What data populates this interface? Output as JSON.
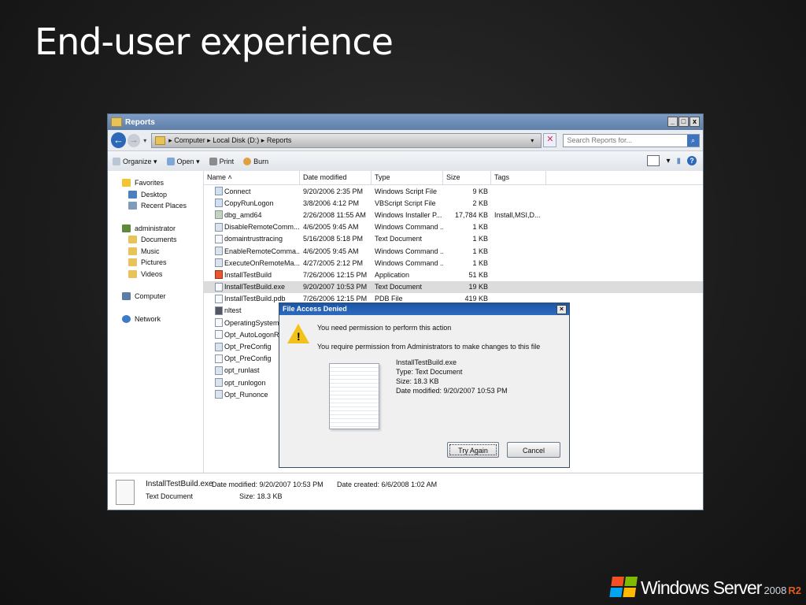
{
  "slide": {
    "title": "End-user experience",
    "brand": {
      "name": "Windows Server",
      "year": "2008",
      "edition": "R2"
    }
  },
  "window": {
    "title": "Reports",
    "controls": [
      "_",
      "□",
      "x"
    ],
    "address": {
      "crumbs": "▸ Computer ▸ Local Disk (D:) ▸ Reports"
    },
    "search": {
      "placeholder": "Search Reports for..."
    },
    "toolbar": {
      "organize": "Organize ▾",
      "open": "Open ▾",
      "print": "Print",
      "burn": "Burn"
    },
    "nav": {
      "favorites": "Favorites",
      "desktop": "Desktop",
      "recent": "Recent Places",
      "user": "administrator",
      "documents": "Documents",
      "music": "Music",
      "pictures": "Pictures",
      "videos": "Videos",
      "computer": "Computer",
      "network": "Network"
    },
    "columns": {
      "name": "Name",
      "date": "Date modified",
      "type": "Type",
      "size": "Size",
      "tags": "Tags"
    },
    "files": [
      {
        "name": "Connect",
        "date": "9/20/2006 2:35 PM",
        "type": "Windows Script File",
        "size": "9 KB",
        "tags": ""
      },
      {
        "name": "CopyRunLogon",
        "date": "3/8/2006 4:12 PM",
        "type": "VBScript Script File",
        "size": "2 KB",
        "tags": ""
      },
      {
        "name": "dbg_amd64",
        "date": "2/26/2008 11:55 AM",
        "type": "Windows Installer P...",
        "size": "17,784 KB",
        "tags": "Install,MSI,D..."
      },
      {
        "name": "DisableRemoteComm...",
        "date": "4/6/2005 9:45 AM",
        "type": "Windows Command ...",
        "size": "1 KB",
        "tags": ""
      },
      {
        "name": "domaintrusttracing",
        "date": "5/16/2008 5:18 PM",
        "type": "Text Document",
        "size": "1 KB",
        "tags": ""
      },
      {
        "name": "EnableRemoteComma...",
        "date": "4/6/2005 9:45 AM",
        "type": "Windows Command ...",
        "size": "1 KB",
        "tags": ""
      },
      {
        "name": "ExecuteOnRemoteMa...",
        "date": "4/27/2005 2:12 PM",
        "type": "Windows Command ...",
        "size": "1 KB",
        "tags": ""
      },
      {
        "name": "InstallTestBuild",
        "date": "7/26/2006 12:15 PM",
        "type": "Application",
        "size": "51 KB",
        "tags": ""
      },
      {
        "name": "InstallTestBuild.exe",
        "date": "9/20/2007 10:53 PM",
        "type": "Text Document",
        "size": "19 KB",
        "tags": ""
      },
      {
        "name": "InstallTestBuild.pdb",
        "date": "7/26/2006 12:15 PM",
        "type": "PDB File",
        "size": "419 KB",
        "tags": ""
      },
      {
        "name": "nltest",
        "date": "",
        "type": "",
        "size": "",
        "tags": ""
      },
      {
        "name": "OperatingSystemSI",
        "date": "",
        "type": "",
        "size": "",
        "tags": ""
      },
      {
        "name": "Opt_AutoLogonRu",
        "date": "",
        "type": "",
        "size": "",
        "tags": ""
      },
      {
        "name": "Opt_PreConfig",
        "date": "",
        "type": "",
        "size": "",
        "tags": ""
      },
      {
        "name": "Opt_PreConfig",
        "date": "",
        "type": "",
        "size": "",
        "tags": ""
      },
      {
        "name": "opt_runlast",
        "date": "",
        "type": "",
        "size": "",
        "tags": ""
      },
      {
        "name": "opt_runlogon",
        "date": "",
        "type": "",
        "size": "",
        "tags": ""
      },
      {
        "name": "Opt_Runonce",
        "date": "",
        "type": "",
        "size": "",
        "tags": ""
      }
    ],
    "details": {
      "name": "InstallTestBuild.exe",
      "kind": "Text Document",
      "modified": "Date modified: 9/20/2007 10:53 PM",
      "size": "Size: 18.3 KB",
      "created": "Date created: 6/6/2008 1:02 AM"
    }
  },
  "dialog": {
    "title": "File Access Denied",
    "message1": "You need permission to perform this action",
    "message2": "You require permission from Administrators to make changes to this file",
    "file": {
      "name": "InstallTestBuild.exe",
      "type": "Type: Text Document",
      "size": "Size: 18.3 KB",
      "modified": "Date modified: 9/20/2007 10:53 PM"
    },
    "try_again": "Try Again",
    "cancel": "Cancel"
  }
}
